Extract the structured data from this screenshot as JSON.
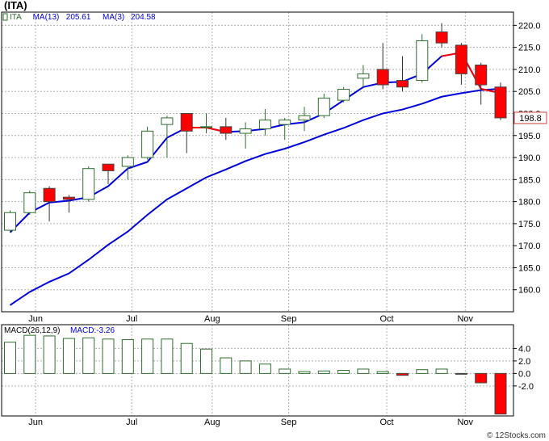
{
  "header": {
    "title": "(ITA)"
  },
  "footer": {
    "text": "© 12Stocks.com"
  },
  "colors": {
    "up": "#2e6e2e",
    "down": "#ff0000",
    "ma13": "#0000dd",
    "ma3": "#ff0000",
    "grid": "#b0b0b0",
    "frame": "#000000"
  },
  "chart_data": [
    {
      "type": "candlestick",
      "legend": [
        {
          "label": "ITA",
          "color": "#2e6e2e"
        },
        {
          "label": "MA(13)",
          "value": "205.61",
          "color": "#0000dd"
        },
        {
          "label": "MA(3)",
          "value": "204.58",
          "color": "#0000dd"
        }
      ],
      "last_price_label": "198.8",
      "ylim": [
        155,
        223
      ],
      "y_ticks": [
        160.0,
        165.0,
        170.0,
        175.0,
        180.0,
        185.0,
        190.0,
        195.0,
        200.0,
        205.0,
        210.0,
        215.0,
        220.0
      ],
      "y_tick_labels": [
        "160.0",
        "165.0",
        "170.0",
        "175.0",
        "180.0",
        "185.0",
        "190.0",
        "195.0",
        "200.0",
        "205.0",
        "210.0",
        "215.0",
        "220.0"
      ],
      "x_months": [
        {
          "label": "Jun",
          "index": 1.3
        },
        {
          "label": "Jul",
          "index": 6.2
        },
        {
          "label": "Aug",
          "index": 10.3
        },
        {
          "label": "Sep",
          "index": 14.2
        },
        {
          "label": "Oct",
          "index": 19.2
        },
        {
          "label": "Nov",
          "index": 23.2
        }
      ],
      "candles": [
        {
          "open": 173.5,
          "close": 177.5,
          "high": 178.0,
          "low": 173.0
        },
        {
          "open": 177.5,
          "close": 182.0,
          "high": 182.5,
          "low": 177.0
        },
        {
          "open": 183.0,
          "close": 180.0,
          "high": 183.5,
          "low": 175.5
        },
        {
          "open": 181.0,
          "close": 180.5,
          "high": 181.5,
          "low": 177.5
        },
        {
          "open": 180.5,
          "close": 187.5,
          "high": 188.0,
          "low": 180.0
        },
        {
          "open": 188.5,
          "close": 187.0,
          "high": 188.5,
          "low": 184.0
        },
        {
          "open": 188.0,
          "close": 190.0,
          "high": 190.5,
          "low": 185.0
        },
        {
          "open": 190.0,
          "close": 196.0,
          "high": 197.0,
          "low": 189.5
        },
        {
          "open": 197.5,
          "close": 199.0,
          "high": 199.5,
          "low": 190.0
        },
        {
          "open": 200.0,
          "close": 196.0,
          "high": 200.0,
          "low": 191.0
        },
        {
          "open": 197.0,
          "close": 197.0,
          "high": 200.0,
          "low": 195.5
        },
        {
          "open": 197.0,
          "close": 195.5,
          "high": 199.0,
          "low": 194.0
        },
        {
          "open": 195.5,
          "close": 196.5,
          "high": 198.0,
          "low": 192.0
        },
        {
          "open": 196.5,
          "close": 198.5,
          "high": 201.0,
          "low": 195.0
        },
        {
          "open": 197.5,
          "close": 198.5,
          "high": 199.0,
          "low": 194.0
        },
        {
          "open": 198.5,
          "close": 199.5,
          "high": 201.5,
          "low": 196.0
        },
        {
          "open": 199.5,
          "close": 203.5,
          "high": 204.5,
          "low": 199.0
        },
        {
          "open": 203.0,
          "close": 205.5,
          "high": 206.0,
          "low": 202.5
        },
        {
          "open": 208.0,
          "close": 209.0,
          "high": 211.0,
          "low": 206.0
        },
        {
          "open": 210.0,
          "close": 206.5,
          "high": 216.0,
          "low": 205.5
        },
        {
          "open": 207.5,
          "close": 206.0,
          "high": 213.0,
          "low": 205.0
        },
        {
          "open": 207.5,
          "close": 216.5,
          "high": 218.0,
          "low": 207.0
        },
        {
          "open": 218.5,
          "close": 216.0,
          "high": 220.5,
          "low": 215.0
        },
        {
          "open": 215.5,
          "close": 209.0,
          "high": 216.0,
          "low": 206.5
        },
        {
          "open": 211.0,
          "close": 206.5,
          "high": 211.5,
          "low": 202.0
        },
        {
          "open": 206.0,
          "close": 199.0,
          "high": 207.0,
          "low": 198.5
        }
      ],
      "ma13": [
        156.5,
        159.5,
        161.8,
        163.7,
        166.8,
        170.2,
        173.2,
        177.0,
        180.5,
        183.0,
        185.5,
        187.3,
        189.2,
        190.8,
        192.0,
        193.5,
        195.2,
        196.7,
        198.5,
        200.0,
        200.9,
        202.2,
        203.8,
        204.6,
        205.3,
        205.6
      ],
      "ma3": [
        173.0,
        177.5,
        179.8,
        180.2,
        181.0,
        183.5,
        187.5,
        189.0,
        194.5,
        196.8,
        196.8,
        195.8,
        196.0,
        196.5,
        197.5,
        198.0,
        200.0,
        203.0,
        206.0,
        207.0,
        207.2,
        209.0,
        213.0,
        213.8,
        205.6,
        204.6
      ],
      "ma3_red_segments": [
        [
          9,
          11
        ],
        [
          22,
          25
        ]
      ]
    },
    {
      "type": "bar",
      "title": "MACD(26,12,9)",
      "value_label": "MACD:",
      "value": "-3.26",
      "ylim": [
        -6.8,
        7.8
      ],
      "y_ticks": [
        4.0,
        2.0,
        0.0,
        -2.0
      ],
      "y_tick_labels": [
        "4.0",
        "2.0",
        "0.0",
        "-2.0"
      ],
      "values": [
        5.0,
        6.1,
        6.0,
        5.6,
        5.7,
        5.5,
        5.4,
        5.5,
        5.5,
        4.8,
        3.9,
        2.5,
        2.0,
        1.5,
        0.7,
        0.3,
        0.4,
        0.5,
        0.7,
        0.3,
        -0.3,
        0.6,
        0.7,
        -0.1,
        -1.5,
        -6.5
      ]
    }
  ]
}
